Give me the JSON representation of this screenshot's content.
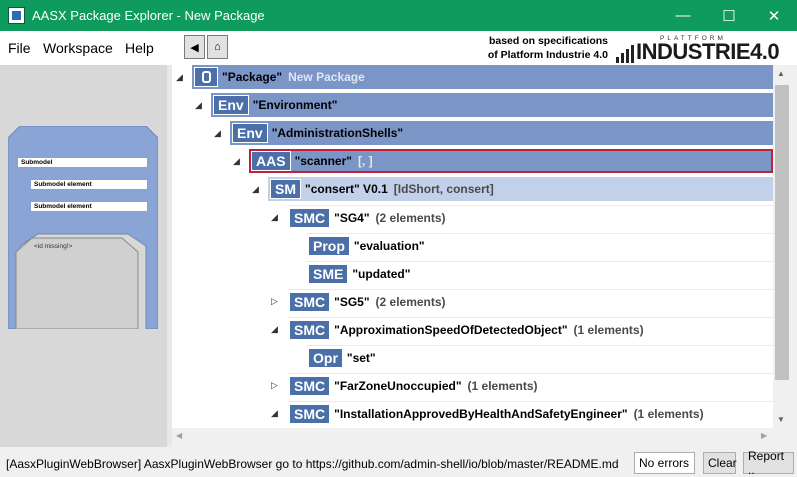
{
  "window": {
    "title": "AASX Package Explorer - New Package",
    "controls": {
      "minimize": "—",
      "maximize": "☐",
      "close": "✕"
    }
  },
  "menu": {
    "items": [
      "File",
      "Workspace",
      "Help"
    ],
    "back_glyph": "◀",
    "home_glyph": "⌂"
  },
  "header": {
    "spec_line1": "based on specifications",
    "spec_line2": "of Platform Industrie 4.0",
    "logo_top": "PLATTFORM",
    "logo_main": "INDUSTRIE",
    "logo_version": "4.0"
  },
  "preview": {
    "submodel_label": "Submodel",
    "element_labels": [
      "Submodel element",
      "Submodel element"
    ],
    "missing_label": "<id missing!>"
  },
  "tree": {
    "rows": [
      {
        "badge": "",
        "name": "\"Package\"",
        "info": "New Package",
        "style": "hl",
        "indent": 0,
        "expander": "◢"
      },
      {
        "badge": "Env",
        "name": "\"Environment\"",
        "info": "",
        "style": "hl",
        "indent": 1,
        "expander": "◢"
      },
      {
        "badge": "Env",
        "name": "\"AdministrationShells\"",
        "info": "",
        "style": "hl",
        "indent": 2,
        "expander": "◢"
      },
      {
        "badge": "AAS",
        "name": "\"scanner\"",
        "info": "[, ]",
        "style": "hl-red",
        "indent": 3,
        "expander": "◢"
      },
      {
        "badge": "SM",
        "name": "\"consert\" V0.1",
        "info": "[IdShort, consert]",
        "style": "hl-light",
        "indent": 4,
        "expander": "◢"
      },
      {
        "badge": "SMC",
        "name": "\"SG4\"",
        "info": "(2 elements)",
        "style": "plain",
        "indent": 5,
        "expander": "◢"
      },
      {
        "badge": "Prop",
        "name": "\"evaluation\"",
        "info": "",
        "style": "plain",
        "indent": 6,
        "expander": ""
      },
      {
        "badge": "SME",
        "name": "\"updated\"",
        "info": "",
        "style": "plain",
        "indent": 6,
        "expander": ""
      },
      {
        "badge": "SMC",
        "name": "\"SG5\"",
        "info": "(2 elements)",
        "style": "plain",
        "indent": 5,
        "expander": "▷"
      },
      {
        "badge": "SMC",
        "name": "\"ApproximationSpeedOfDetectedObject\"",
        "info": "(1 elements)",
        "style": "plain",
        "indent": 5,
        "expander": "◢"
      },
      {
        "badge": "Opr",
        "name": "\"set\"",
        "info": "",
        "style": "plain",
        "indent": 6,
        "expander": ""
      },
      {
        "badge": "SMC",
        "name": "\"FarZoneUnoccupied\"",
        "info": "(1 elements)",
        "style": "plain",
        "indent": 5,
        "expander": "▷"
      },
      {
        "badge": "SMC",
        "name": "\"InstallationApprovedByHealthAndSafetyEngineer\"",
        "info": "(1 elements)",
        "style": "plain",
        "indent": 5,
        "expander": "◢"
      }
    ]
  },
  "status": {
    "message": "[AasxPluginWebBrowser] AasxPluginWebBrowser go to https://github.com/admin-shell/io/blob/master/README.md",
    "errors": "No errors",
    "clear": "Clear",
    "report": "Report .."
  }
}
